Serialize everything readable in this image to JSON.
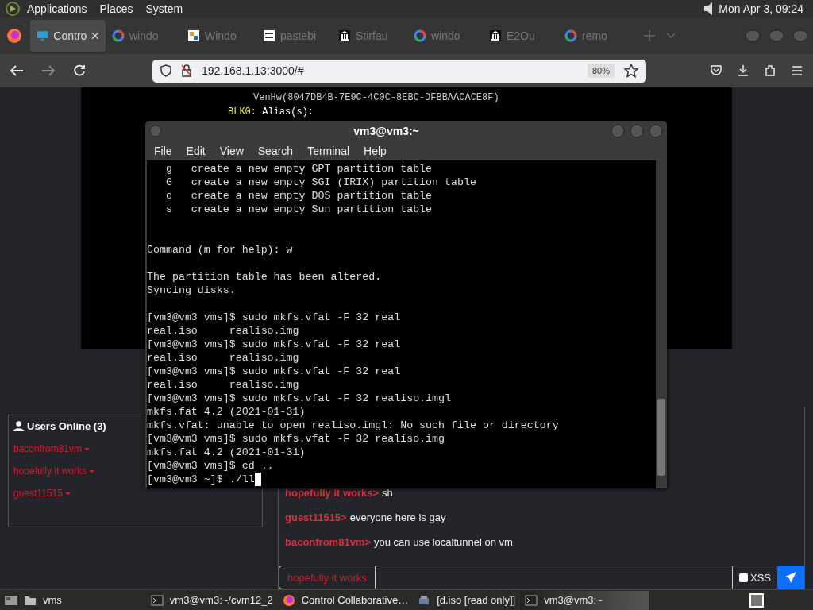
{
  "top_panel": {
    "menus": [
      "Applications",
      "Places",
      "System"
    ],
    "clock": "Mon Apr 3, 09:24"
  },
  "browser": {
    "tabs": [
      {
        "label": "Contro",
        "selected": true,
        "kind": "monitor"
      },
      {
        "label": "windo",
        "selected": false,
        "kind": "ring"
      },
      {
        "label": "Windo",
        "selected": false,
        "kind": "tile"
      },
      {
        "label": "pastebi",
        "selected": false,
        "kind": "grid"
      },
      {
        "label": "Stirfau",
        "selected": false,
        "kind": "temple"
      },
      {
        "label": "windo",
        "selected": false,
        "kind": "ring"
      },
      {
        "label": "E2Ou",
        "selected": false,
        "kind": "temple"
      },
      {
        "label": "remo",
        "selected": false,
        "kind": "ring"
      }
    ],
    "url": "192.168.1.13:3000/#",
    "zoom": "80%"
  },
  "remote_screen": {
    "lines": [
      {
        "kind": "value",
        "text": "VenHw(8047DB4B-7E9C-4C0C-8EBC-DFBBAACACE8F)"
      },
      {
        "kind": "device",
        "label": "BLK0:",
        "text": "Alias(s):"
      }
    ]
  },
  "users": {
    "title": "Users Online (3)",
    "items": [
      "baconfrom81vm",
      "hopefully it works",
      "guest11515"
    ]
  },
  "chat": {
    "messages": [
      {
        "user": "hopefully it works>",
        "text": "sh"
      },
      {
        "user": "guest11515>",
        "text": "everyone here is gay"
      },
      {
        "user": "baconfrom81vm>",
        "text": "you can use localtunnel on vm"
      }
    ],
    "username": "hopefully it works",
    "xss": {
      "label": "XSS",
      "checked": false
    }
  },
  "terminal": {
    "title": "vm3@vm3:~",
    "menus": [
      "File",
      "Edit",
      "View",
      "Search",
      "Terminal",
      "Help"
    ],
    "lines": [
      {
        "kind": "text",
        "text": "   g   create a new empty GPT partition table"
      },
      {
        "kind": "text",
        "text": "   G   create a new empty SGI (IRIX) partition table"
      },
      {
        "kind": "text",
        "text": "   o   create a new empty DOS partition table"
      },
      {
        "kind": "text",
        "text": "   s   create a new empty Sun partition table"
      },
      {
        "kind": "blank"
      },
      {
        "kind": "blank"
      },
      {
        "kind": "text",
        "text": "Command (m for help): w"
      },
      {
        "kind": "blank"
      },
      {
        "kind": "text",
        "text": "The partition table has been altered."
      },
      {
        "kind": "text",
        "text": "Syncing disks."
      },
      {
        "kind": "blank"
      },
      {
        "kind": "text",
        "text": "[vm3@vm3 vms]$ sudo mkfs.vfat -F 32 real"
      },
      {
        "kind": "text",
        "text": "real.iso     realiso.img"
      },
      {
        "kind": "text",
        "text": "[vm3@vm3 vms]$ sudo mkfs.vfat -F 32 real"
      },
      {
        "kind": "text",
        "text": "real.iso     realiso.img"
      },
      {
        "kind": "text",
        "text": "[vm3@vm3 vms]$ sudo mkfs.vfat -F 32 real"
      },
      {
        "kind": "text",
        "text": "real.iso     realiso.img"
      },
      {
        "kind": "text",
        "text": "[vm3@vm3 vms]$ sudo mkfs.vfat -F 32 realiso.imgl"
      },
      {
        "kind": "text",
        "text": "mkfs.fat 4.2 (2021-01-31)"
      },
      {
        "kind": "text",
        "text": "mkfs.vfat: unable to open realiso.imgl: No such file or directory"
      },
      {
        "kind": "text",
        "text": "[vm3@vm3 vms]$ sudo mkfs.vfat -F 32 realiso.img"
      },
      {
        "kind": "text",
        "text": "mkfs.fat 4.2 (2021-01-31)"
      },
      {
        "kind": "text",
        "text": "[vm3@vm3 vms]$ cd .."
      },
      {
        "kind": "input",
        "text": "[vm3@vm3 ~]$ ./ll"
      }
    ]
  },
  "taskbar": {
    "items": [
      {
        "kind": "folder",
        "label": "vms",
        "selected": false
      },
      {
        "kind": "terminal",
        "label": "vm3@vm3:~/cvm12_2",
        "selected": false
      },
      {
        "kind": "browser",
        "label": "Control Collaborative…",
        "selected": false
      },
      {
        "kind": "disk",
        "label": "[d.iso [read only]]",
        "selected": false
      },
      {
        "kind": "terminal",
        "label": "vm3@vm3:~",
        "selected": true
      }
    ]
  }
}
